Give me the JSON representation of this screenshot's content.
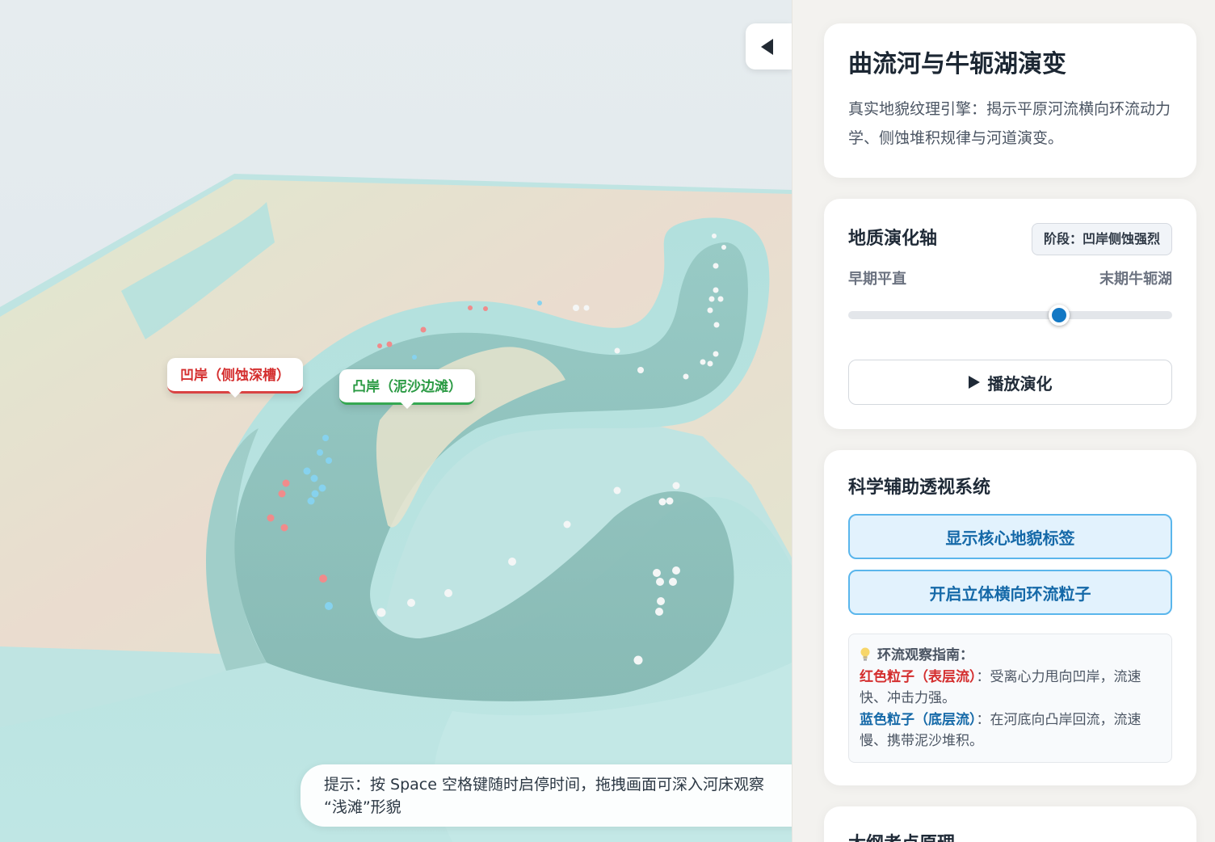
{
  "scene": {
    "label_concave": "凹岸（侧蚀深槽）",
    "label_convex": "凸岸（泥沙边滩）",
    "hint_line1": "提示：按 Space 空格键随时启停时间，拖拽画面可深入河床观察",
    "hint_line2": "“浅滩”形貌",
    "collapse_icon": "chevron-left-icon"
  },
  "sidebar": {
    "intro": {
      "title": "曲流河与牛轭湖演变",
      "desc": "真实地貌纹理引擎：揭示平原河流横向环流动力学、侧蚀堆积规律与河道演变。"
    },
    "timeline": {
      "title": "地质演化轴",
      "stage": "阶段：凹岸侧蚀强烈",
      "start_label": "早期平直",
      "end_label": "末期牛轭湖",
      "value": 0.65,
      "play_label": "播放演化"
    },
    "assist": {
      "title": "科学辅助透视系统",
      "btn_labels": "显示核心地貌标签",
      "btn_particles": "开启立体横向环流粒子",
      "guide_title": "环流观察指南：",
      "red_name": "红色粒子（表层流）",
      "red_desc": "：受离心力甩向凹岸，流速快、冲击力强。",
      "blue_name": "蓝色粒子（底层流）",
      "blue_desc": "：在河底向凸岸回流，流速慢、携带泥沙堆积。"
    },
    "next_title": "大纲考点原理"
  },
  "colors": {
    "accent": "#1378c4",
    "red": "#d42e2e",
    "green": "#2a9a43",
    "water": "#a8dcda"
  }
}
